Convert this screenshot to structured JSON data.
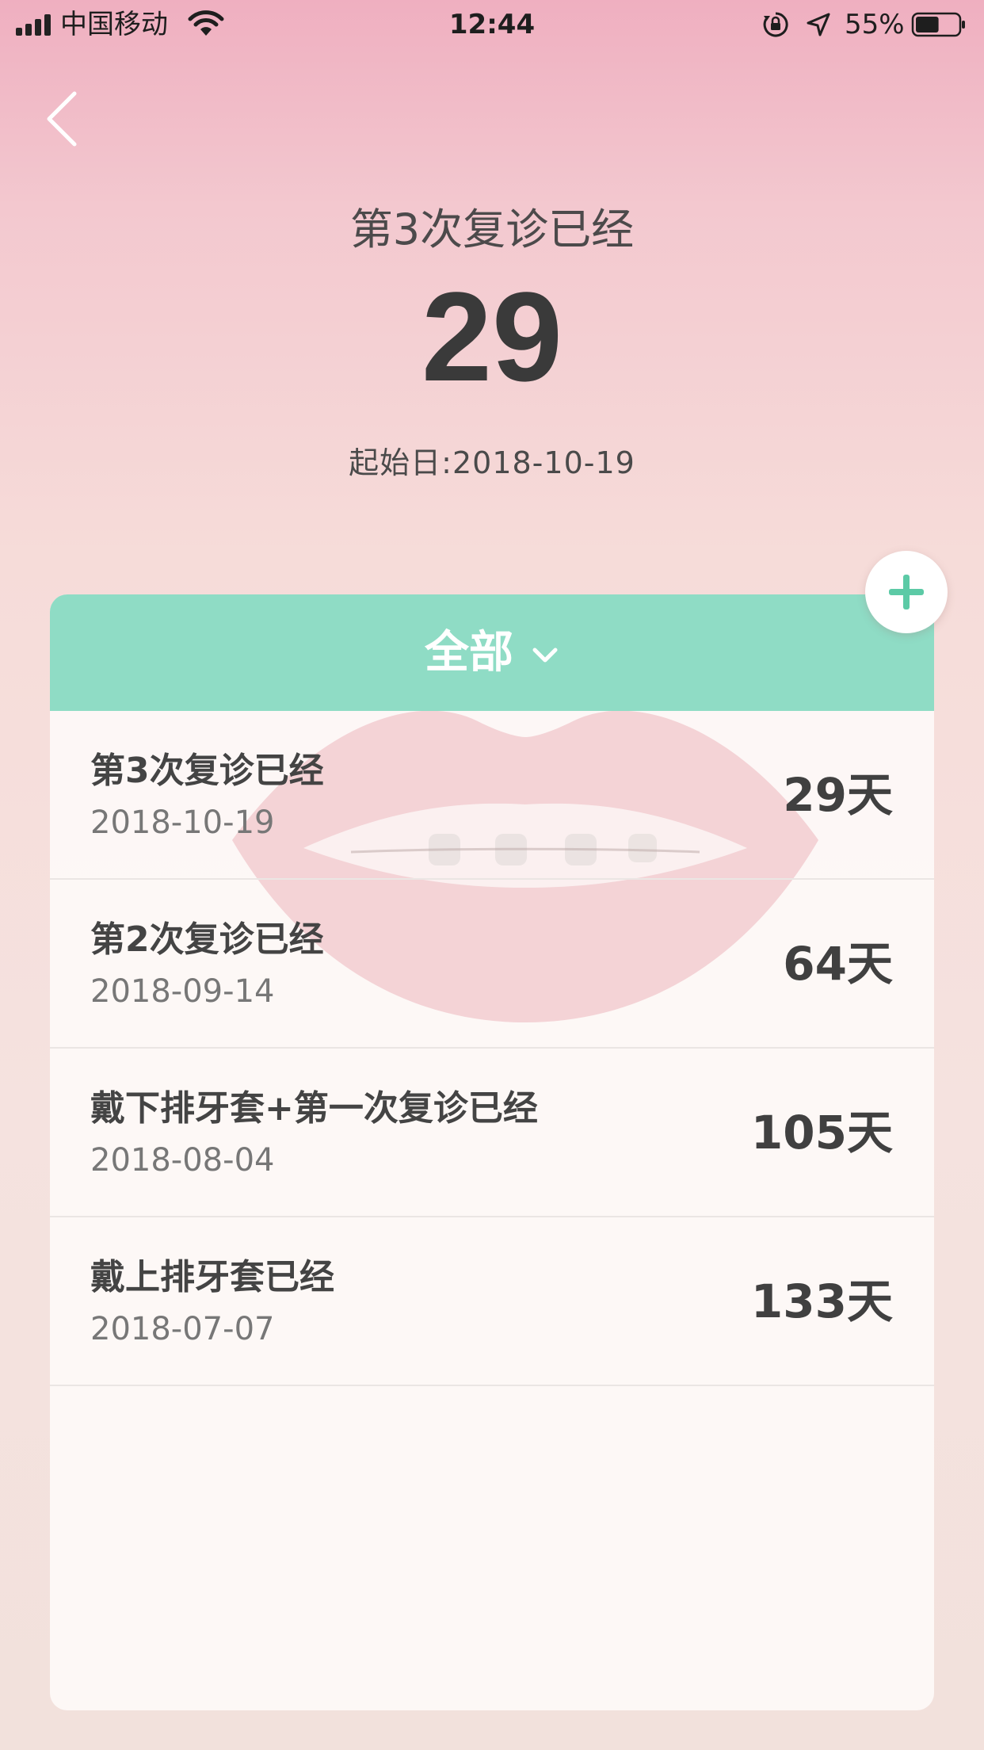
{
  "status_bar": {
    "carrier": "中国移动",
    "time": "12:44",
    "battery_percent": "55%",
    "battery_level": 0.55,
    "icons": [
      "signal-icon",
      "wifi-icon",
      "orientation-lock-icon",
      "location-icon",
      "battery-icon"
    ]
  },
  "header": {
    "back_icon": "back-chevron-icon",
    "title": "第3次复诊已经",
    "days": "29",
    "start_date": "起始日:2018-10-19"
  },
  "filter": {
    "label": "全部",
    "icon": "chevron-down-icon"
  },
  "add_button": {
    "icon": "plus-icon"
  },
  "events": [
    {
      "title": "第3次复诊已经",
      "date": "2018-10-19",
      "days": "29天"
    },
    {
      "title": "第2次复诊已经",
      "date": "2018-09-14",
      "days": "64天"
    },
    {
      "title": "戴下排牙套+第一次复诊已经",
      "date": "2018-08-04",
      "days": "105天"
    },
    {
      "title": "戴上排牙套已经",
      "date": "2018-07-07",
      "days": "133天"
    }
  ],
  "colors": {
    "accent": "#8fdcc5",
    "plus": "#5ccaa6",
    "background_top": "#efafc0",
    "background_bottom": "#f2e1dc"
  }
}
